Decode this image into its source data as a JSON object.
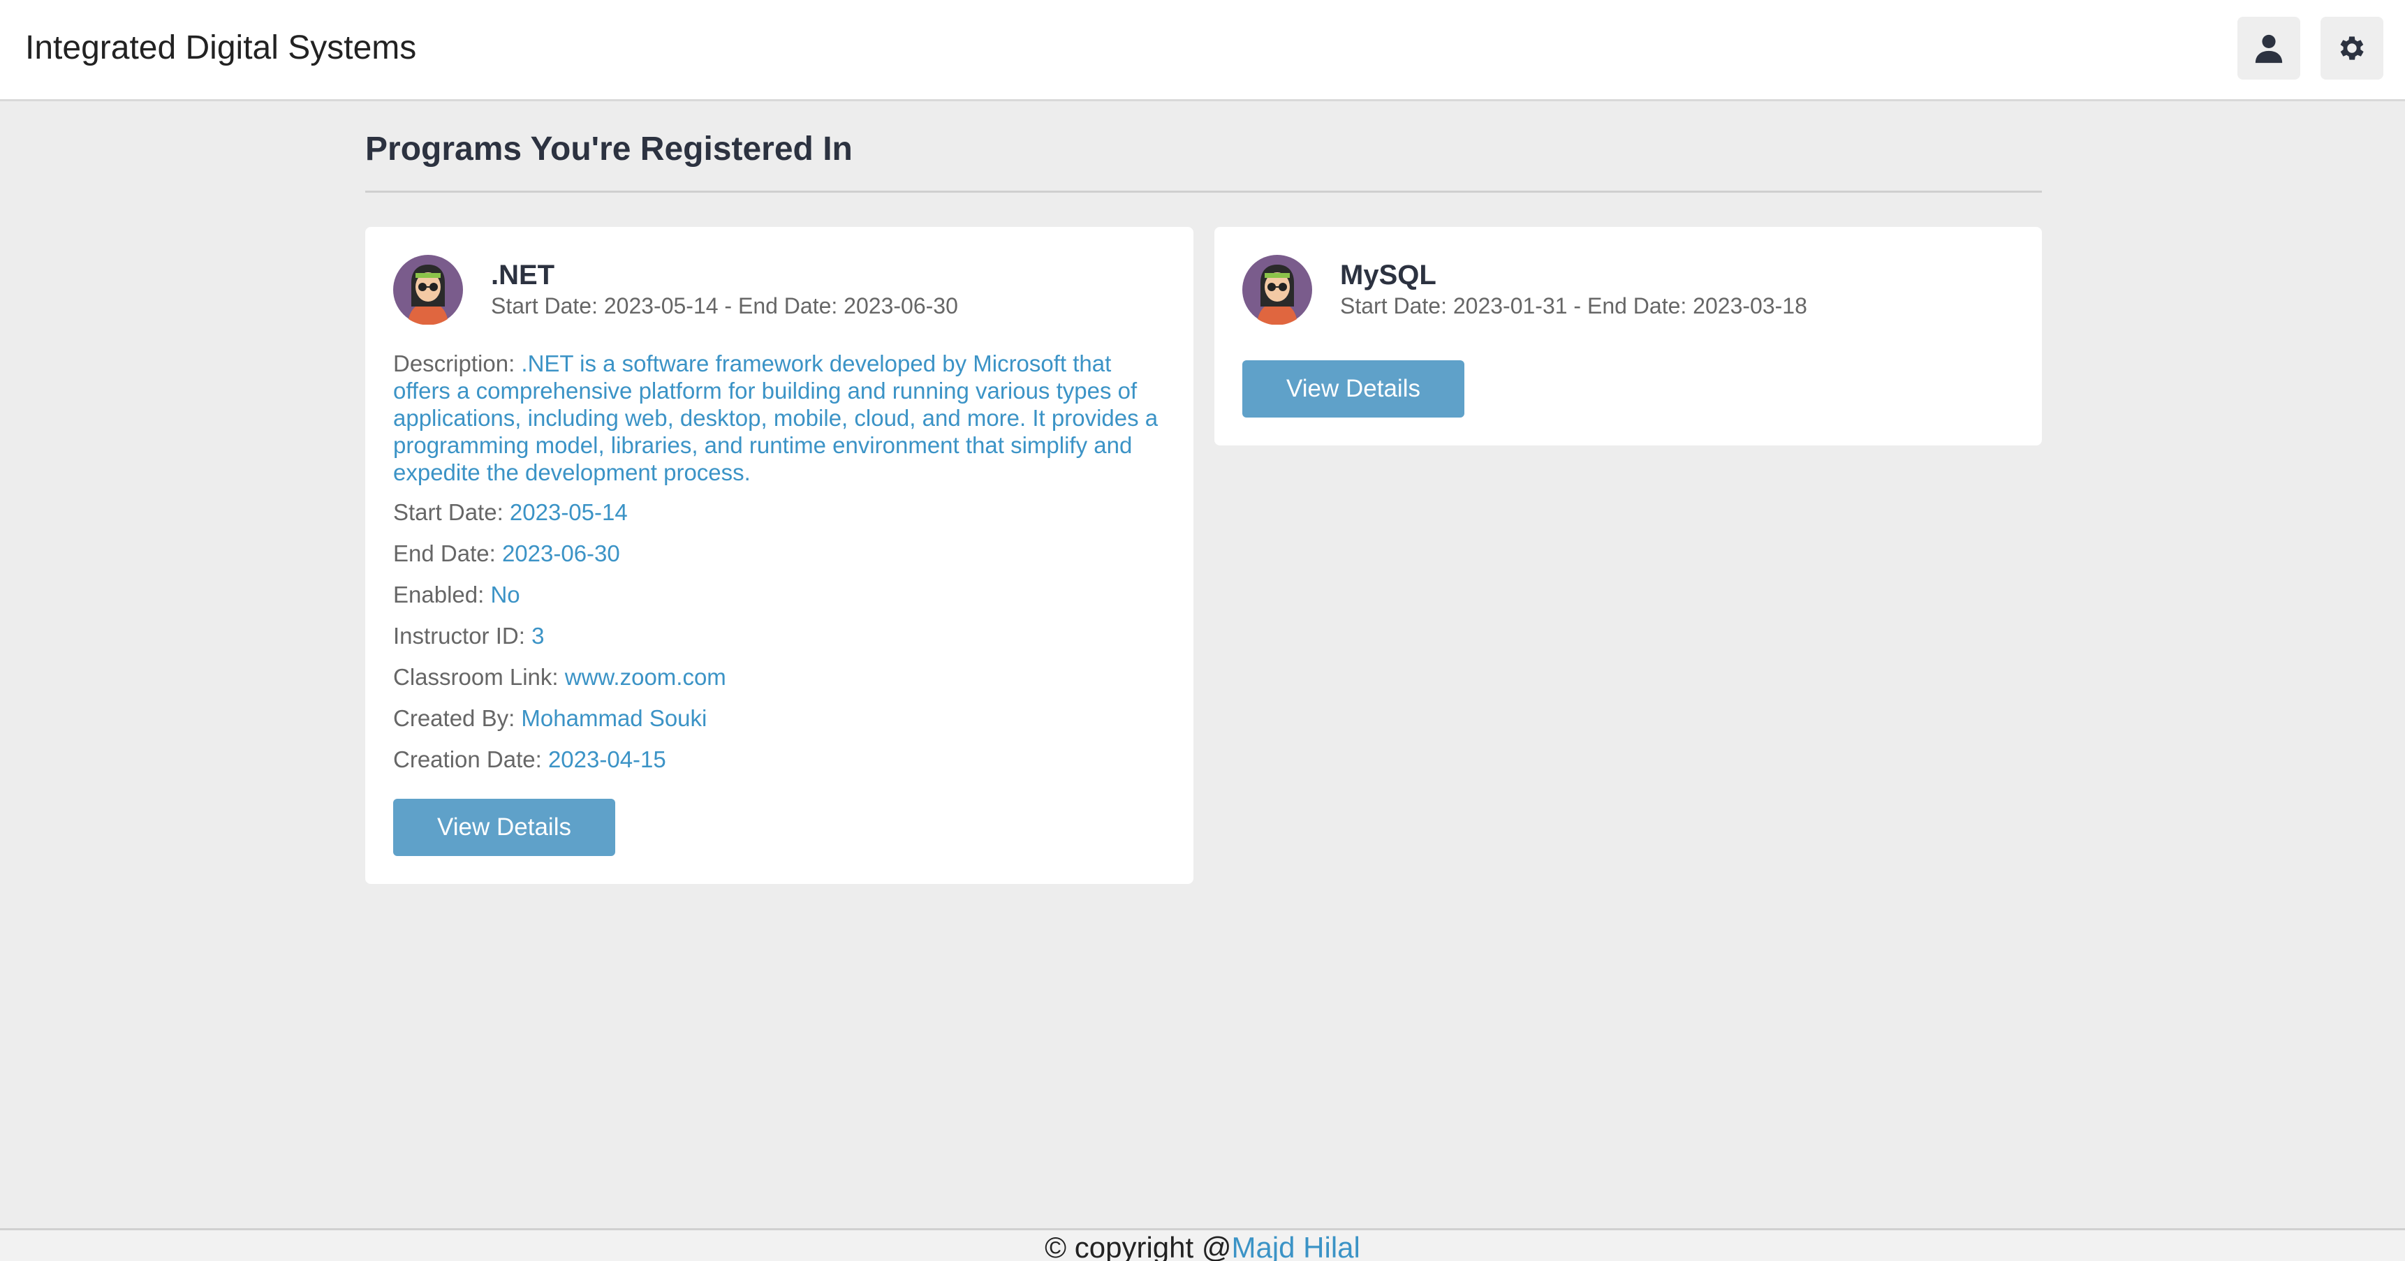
{
  "header": {
    "app_title": "Integrated Digital Systems",
    "icons": [
      "user-icon",
      "gear-icon"
    ]
  },
  "main": {
    "heading": "Programs You're Registered In",
    "programs": [
      {
        "name": ".NET",
        "dates_line": "Start Date: 2023-05-14 - End Date: 2023-06-30",
        "description_label": "Description: ",
        "description": ".NET is a software framework developed by Microsoft that offers a comprehensive platform for building and running various types of applications, including web, desktop, mobile, cloud, and more. It provides a programming model, libraries, and runtime environment that simplify and expedite the development process.",
        "fields": [
          {
            "label": "Start Date: ",
            "value": "2023-05-14"
          },
          {
            "label": "End Date: ",
            "value": "2023-06-30"
          },
          {
            "label": "Enabled: ",
            "value": "No"
          },
          {
            "label": "Instructor ID: ",
            "value": "3"
          },
          {
            "label": "Classroom Link: ",
            "value": "www.zoom.com"
          },
          {
            "label": "Created By: ",
            "value": "Mohammad Souki"
          },
          {
            "label": "Creation Date: ",
            "value": "2023-04-15"
          }
        ],
        "button_label": "View Details"
      },
      {
        "name": "MySQL",
        "dates_line": "Start Date: 2023-01-31 - End Date: 2023-03-18",
        "button_label": "View Details"
      }
    ]
  },
  "footer": {
    "prefix": "© copyright @",
    "author": "Majd Hilal"
  },
  "colors": {
    "accent": "#3b93c6",
    "button": "#5fa1c9",
    "background": "#ededed"
  }
}
